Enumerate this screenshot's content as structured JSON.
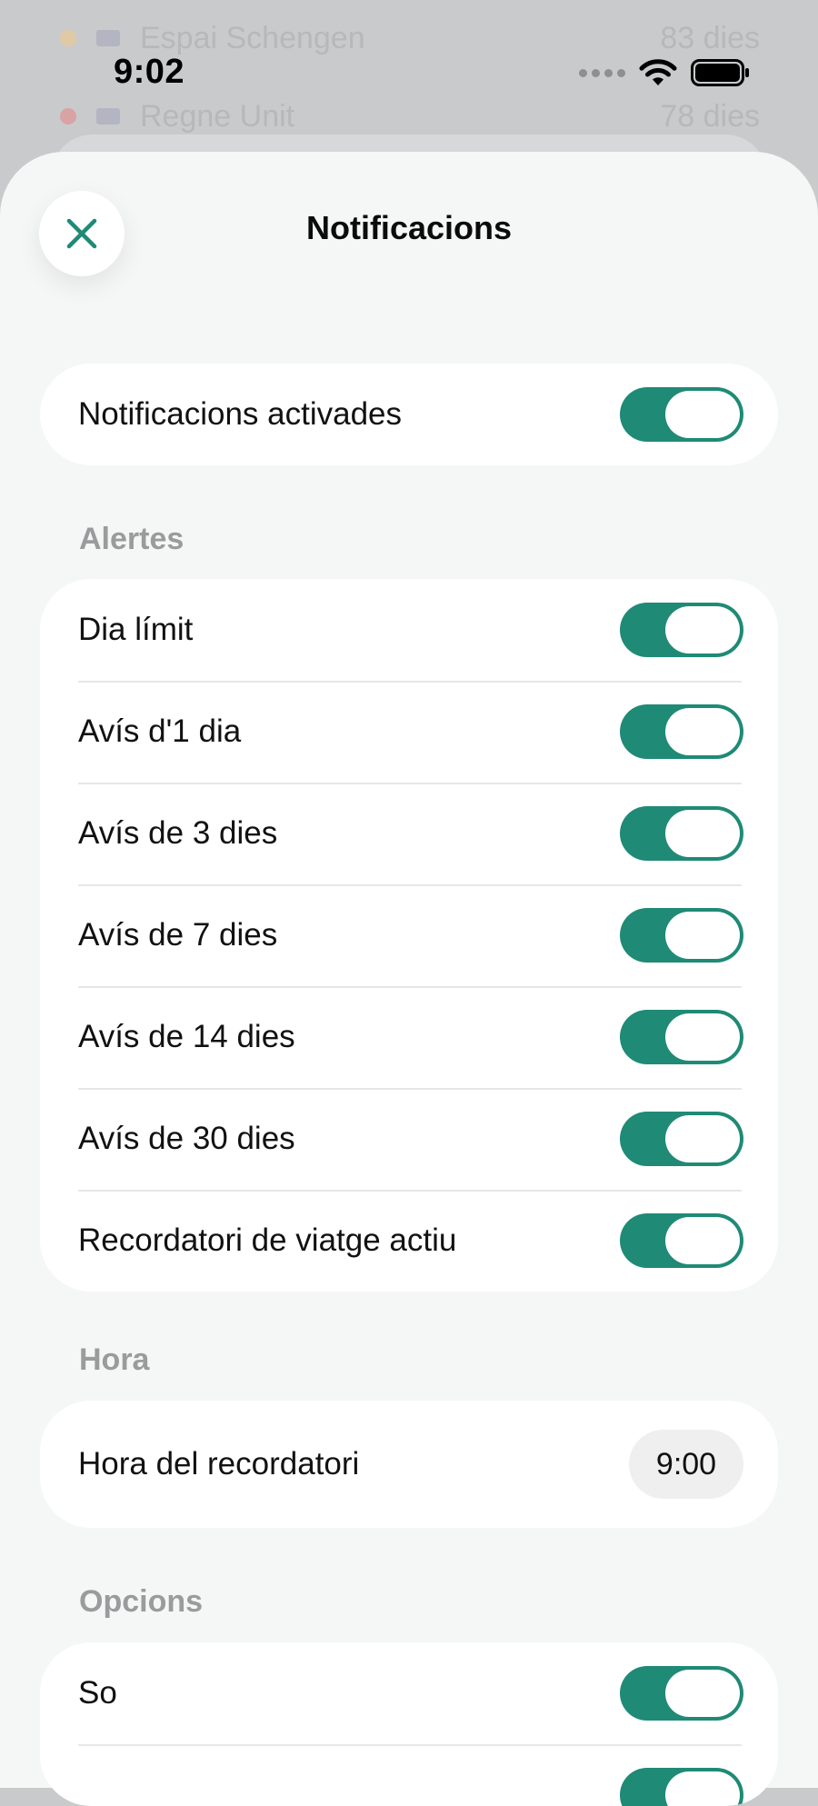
{
  "background": {
    "rows": [
      {
        "label": "Espai Schengen",
        "days": "83 dies",
        "dot_color": "#e0c9a5"
      },
      {
        "label": "Regne Unit",
        "days": "78 dies",
        "dot_color": "#d9a3a3"
      }
    ]
  },
  "status_bar": {
    "time": "9:02"
  },
  "sheet": {
    "title": "Notificacions",
    "close_icon": "close-icon"
  },
  "master": {
    "label": "Notificacions activades",
    "enabled": true
  },
  "alerts": {
    "header": "Alertes",
    "items": [
      {
        "label": "Dia límit",
        "enabled": true
      },
      {
        "label": "Avís d'1 dia",
        "enabled": true
      },
      {
        "label": "Avís de 3 dies",
        "enabled": true
      },
      {
        "label": "Avís de 7 dies",
        "enabled": true
      },
      {
        "label": "Avís de 14 dies",
        "enabled": true
      },
      {
        "label": "Avís de 30 dies",
        "enabled": true
      },
      {
        "label": "Recordatori de viatge actiu",
        "enabled": true
      }
    ]
  },
  "time_section": {
    "header": "Hora",
    "label": "Hora del recordatori",
    "value": "9:00"
  },
  "options": {
    "header": "Opcions",
    "items": [
      {
        "label": "So",
        "enabled": true
      },
      {
        "label": "",
        "enabled": true
      }
    ]
  },
  "colors": {
    "accent": "#1f8a76",
    "sheet_background": "#f5f6f6",
    "card_background": "#ffffff",
    "section_header": "#9a9b9c"
  }
}
